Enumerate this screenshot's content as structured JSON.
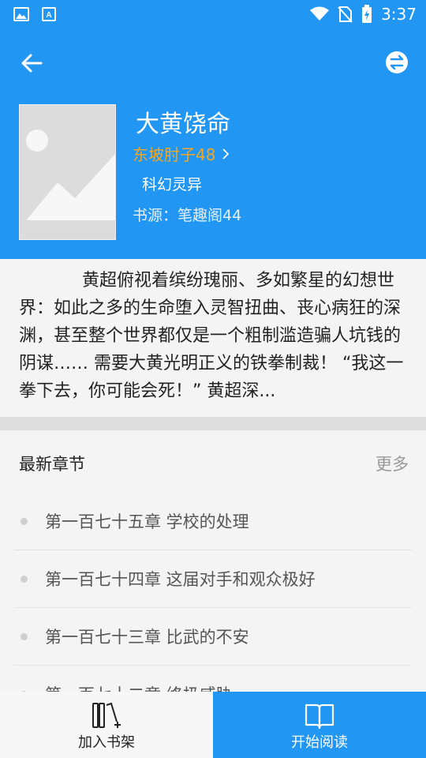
{
  "status_bar": {
    "time": "3:37"
  },
  "book": {
    "title": "大黄饶命",
    "author": "东坡肘子48",
    "genre": "科幻灵异",
    "source": "书源：笔趣阁44"
  },
  "description": "黄超俯视着缤纷瑰丽、多如繁星的幻想世界：如此之多的生命堕入灵智扭曲、丧心病狂的深渊，甚至整个世界都仅是一个粗制滥造骗人坑钱的阴谋…… 需要大黄光明正义的铁拳制裁！ “我这一拳下去，你可能会死！” 黄超深...",
  "latest": {
    "title": "最新章节",
    "more": "更多",
    "chapters": [
      "第一百七十五章 学校的处理",
      "第一百七十四章 这届对手和观众极好",
      "第一百七十三章 比武的不安",
      "第一百七十二章 终极威胁"
    ]
  },
  "actions": {
    "add_to_shelf": "加入书架",
    "start_reading": "开始阅读"
  },
  "colors": {
    "primary": "#2196f3",
    "author": "#f5a623"
  }
}
